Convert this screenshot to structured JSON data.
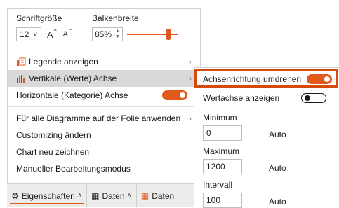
{
  "font": {
    "label": "Schriftgröße",
    "size_value": "12",
    "increase_label": "A",
    "decrease_label": "A"
  },
  "bar": {
    "label": "Balkenbreite",
    "value": "85%",
    "slider_fraction": 0.85
  },
  "menu": {
    "legend": "Legende anzeigen",
    "vertical_axis": "Vertikale (Werte) Achse",
    "horizontal_axis": "Horizontale (Kategorie) Achse",
    "apply_all": "Für alle Diagramme auf der Folie anwenden",
    "customizing": "Customizing ändern",
    "redraw": "Chart neu zeichnen",
    "manual_edit": "Manueller Bearbeitungsmodus"
  },
  "tabs": {
    "properties": "Eigenschaften",
    "data": "Daten",
    "data2": "Daten"
  },
  "submenu": {
    "reverse_direction": "Achsenrichtung umdrehen",
    "show_axis": "Wertachse anzeigen",
    "min_label": "Minimum",
    "min_value": "0",
    "min_auto": "Auto",
    "max_label": "Maximum",
    "max_value": "1200",
    "max_auto": "Auto",
    "interval_label": "Intervall",
    "interval_value": "100",
    "interval_auto": "Auto"
  },
  "colors": {
    "accent": "#e3581c",
    "highlight_border": "#d84a0a",
    "selected_row": "#d9d9d9"
  }
}
